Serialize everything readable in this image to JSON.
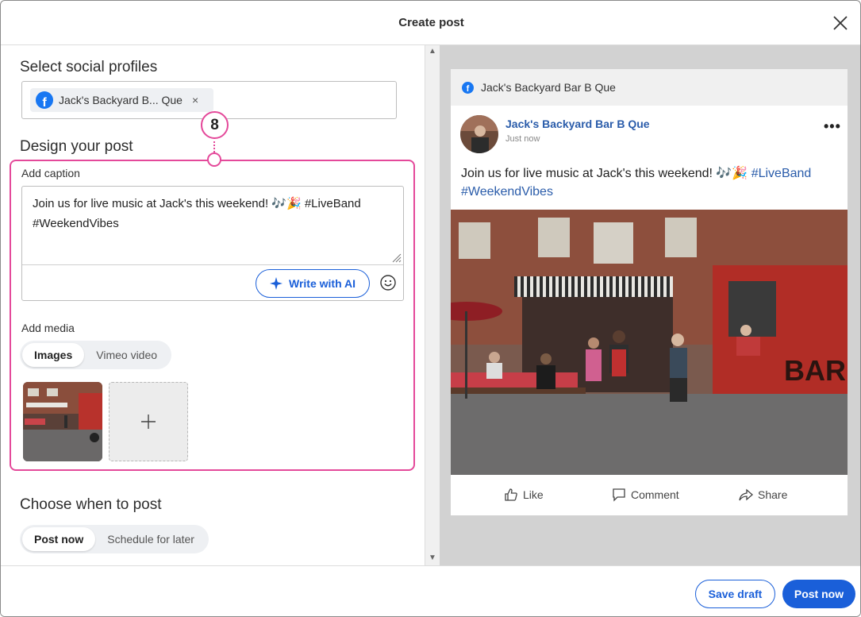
{
  "header": {
    "title": "Create post"
  },
  "profiles": {
    "section_title": "Select social profiles",
    "chip_label": "Jack's Backyard B... Que",
    "chip_remove": "×"
  },
  "design": {
    "section_title": "Design your post",
    "marker_number": "8",
    "caption_label": "Add caption",
    "caption_value": "Join us for live music at Jack's this weekend! 🎶🎉 #LiveBand #WeekendVibes",
    "write_ai_label": "Write with AI",
    "media_label": "Add media",
    "media_tabs": [
      "Images",
      "Vimeo video"
    ],
    "media_tab_selected": "Images"
  },
  "schedule": {
    "section_title": "Choose when to post",
    "options": [
      "Post now",
      "Schedule for later"
    ],
    "selected": "Post now"
  },
  "preview": {
    "network_header": "Jack's Backyard Bar B Que",
    "page_name": "Jack's Backyard Bar B Que",
    "timestamp": "Just now",
    "more": "•••",
    "post_text": "Join us for live music at Jack's this weekend! 🎶🎉",
    "tag1": "#LiveBand",
    "tag2": "#WeekendVibes",
    "actions": {
      "like": "Like",
      "comment": "Comment",
      "share": "Share"
    }
  },
  "footer": {
    "save_draft": "Save draft",
    "post_now": "Post now"
  },
  "colors": {
    "accent": "#1a5fd9",
    "highlight": "#e4499a",
    "facebook": "#1877f2",
    "link": "#2a5caa"
  }
}
